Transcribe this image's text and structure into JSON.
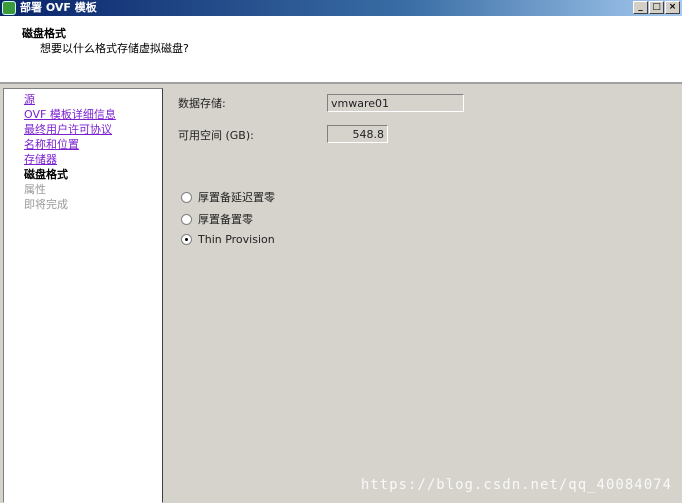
{
  "window": {
    "title": "部署 OVF 模板",
    "minimize": "_",
    "maximize": "□",
    "close": "×"
  },
  "header": {
    "title": "磁盘格式",
    "subtitle": "想要以什么格式存储虚拟磁盘?"
  },
  "nav": {
    "items": [
      {
        "label": "源",
        "state": "link"
      },
      {
        "label": "OVF 模板详细信息",
        "state": "link"
      },
      {
        "label": "最终用户许可协议",
        "state": "link"
      },
      {
        "label": "名称和位置",
        "state": "link"
      },
      {
        "label": "存储器",
        "state": "link"
      },
      {
        "label": "磁盘格式",
        "state": "current"
      },
      {
        "label": "属性",
        "state": "disabled"
      },
      {
        "label": "即将完成",
        "state": "disabled"
      }
    ]
  },
  "main": {
    "datastore_label": "数据存储:",
    "datastore_value": "vmware01",
    "free_space_label": "可用空间 (GB):",
    "free_space_value": "548.8",
    "options": [
      {
        "label": "厚置备延迟置零",
        "selected": false
      },
      {
        "label": "厚置备置零",
        "selected": false
      },
      {
        "label": "Thin Provision",
        "selected": true
      }
    ]
  },
  "watermark": "https://blog.csdn.net/qq_40084074"
}
